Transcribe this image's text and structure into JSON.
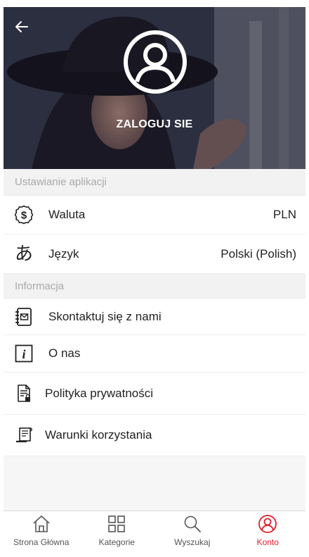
{
  "hero": {
    "login_label": "ZALOGUJ SIE"
  },
  "app_settings": {
    "header": "Ustawianie aplikacji",
    "items": [
      {
        "icon": "dollar-coin-icon",
        "label": "Waluta",
        "value": "PLN"
      },
      {
        "icon": "language-icon",
        "glyph": "あ",
        "label": "Język",
        "value": "Polski (Polish)"
      }
    ]
  },
  "information": {
    "header": "Informacja",
    "items": [
      {
        "icon": "contact-book-icon",
        "label": "Skontaktuj się z nami"
      },
      {
        "icon": "info-icon",
        "label": "O nas"
      },
      {
        "icon": "privacy-document-icon",
        "label": "Polityka prywatności"
      },
      {
        "icon": "terms-scroll-icon",
        "label": "Warunki korzystania"
      }
    ]
  },
  "bottom_nav": {
    "items": [
      {
        "icon": "home-icon",
        "label": "Strona Główna",
        "active": false
      },
      {
        "icon": "categories-grid-icon",
        "label": "Kategorie",
        "active": false
      },
      {
        "icon": "search-icon",
        "label": "Wyszukaj",
        "active": false
      },
      {
        "icon": "account-icon",
        "label": "Konto",
        "active": true
      }
    ]
  },
  "colors": {
    "accent": "#e0202a",
    "section_bg": "#f2f2f2",
    "section_text": "#a9a9a9"
  }
}
